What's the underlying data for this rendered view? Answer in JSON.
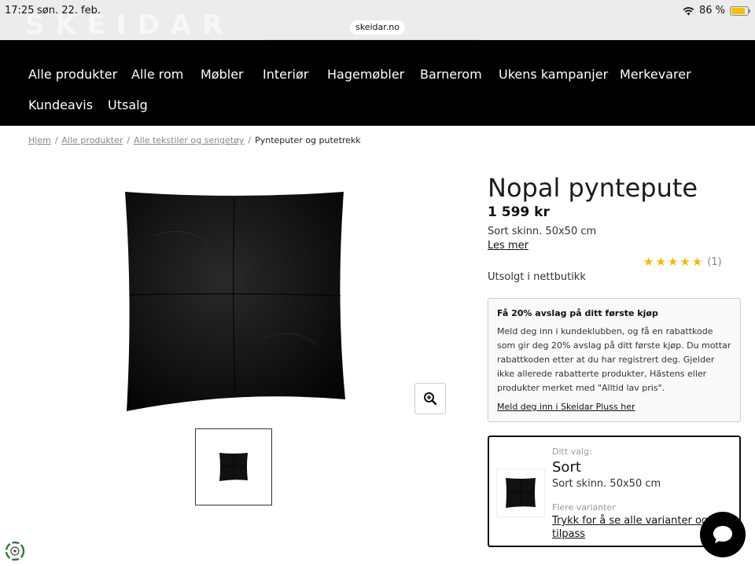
{
  "status_bar": {
    "time": "17:25",
    "date": "søn. 22. feb.",
    "url": "skeidar.no",
    "battery": "86 %",
    "battery_level": 0.86
  },
  "nav": {
    "items": [
      {
        "label": "Alle produkter"
      },
      {
        "label": "Alle rom"
      },
      {
        "label": "Møbler"
      },
      {
        "label": "Interiør"
      },
      {
        "label": "Hagemøbler"
      },
      {
        "label": "Barnerom"
      },
      {
        "label": "Ukens kampanjer"
      },
      {
        "label": "Merkevarer"
      },
      {
        "label": "Kundeavis"
      },
      {
        "label": "Utsalg"
      }
    ]
  },
  "breadcrumb": {
    "items": [
      "Hjem",
      "Alle produkter",
      "Alle tekstiler og sengetøy"
    ],
    "current": "Pynteputer og putetrekk"
  },
  "product": {
    "title": "Nopal pyntepute",
    "price": "1 599 kr",
    "description": "Sort skinn. 50x50 cm",
    "read_more": "Les mer",
    "rating": 5,
    "review_count": "(1)",
    "stock": "Utsolgt i nettbutikk"
  },
  "promo": {
    "title": "Få 20% avslag på ditt første kjøp",
    "body": "Meld deg inn i kundeklubben, og få en rabattkode som gir deg 20% avslag på ditt første kjøp. Du mottar rabattkoden etter at du har registrert deg. Gjelder ikke allerede rabatterte produkter, Hästens eller produkter merket med \"Alltid lav pris\".",
    "link": "Meld deg inn i Skeidar Pluss her"
  },
  "variant": {
    "label": "Ditt valg:",
    "name": "Sort",
    "description": "Sort skinn. 50x50 cm",
    "more_label": "Flere varianter",
    "more_link": "Trykk for å se alle varianter og tilpass"
  },
  "colors": {
    "nav_bg": "#000000",
    "star": "#f5b800",
    "battery": "#f2c200"
  },
  "icons": [
    "wifi-icon",
    "battery-icon",
    "zoom-in-icon",
    "chat-icon",
    "eco-badge-icon"
  ]
}
